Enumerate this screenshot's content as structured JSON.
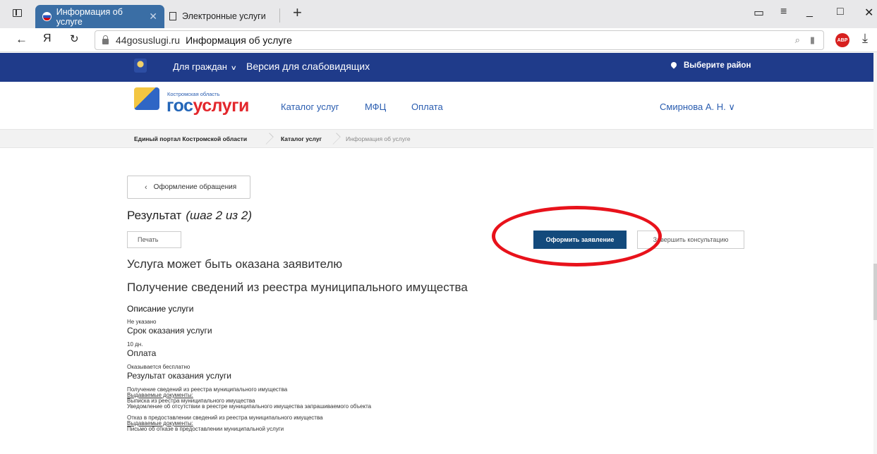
{
  "browser": {
    "active_tab": "Информация об услуге",
    "inactive_tab": "Электронные услуги",
    "yandex_letter": "Я",
    "domain": "44gosuslugi.ru",
    "page_title": "Информация об услуге",
    "abp": "ABP"
  },
  "topbar": {
    "citizens": "Для граждан",
    "vision": "Версия для слабовидящих",
    "district": "Выберите район"
  },
  "header": {
    "logo_region": "Костромская область",
    "logo_gos": "гос",
    "logo_uslugi": "услуги",
    "nav": [
      "Каталог услуг",
      "МФЦ",
      "Оплата"
    ],
    "user": "Смирнова А. Н."
  },
  "breadcrumbs": [
    "Единый портал Костромской области",
    "Каталог услуг",
    "Информация об услуге"
  ],
  "content": {
    "back_label": "Оформление обращения",
    "result_title": "Результат",
    "result_step": "(шаг 2 из 2)",
    "print_label": "Печать",
    "submit_label": "Оформить заявление",
    "finish_label": "Завершить консультацию",
    "served_text": "Услуга может быть оказана заявителю",
    "service_name": "Получение сведений из реестра муниципального имущества",
    "description_heading": "Описание услуги",
    "description_value": "Не указано",
    "term_heading": "Срок оказания услуги",
    "term_value": "10 дн.",
    "payment_heading": "Оплата",
    "payment_value": "Оказывается бесплатно",
    "result_heading": "Результат оказания услуги",
    "result1": {
      "title": "Получение сведений из реестра муниципального имущества",
      "docs_label": "Выдаваемые документы:",
      "docs": [
        "Выписка из реестра муниципального имущества",
        "Уведомление об отсутствии в реестре муниципального имущества запрашиваемого объекта"
      ]
    },
    "result2": {
      "title": "Отказ в предоставлении сведений из реестра муниципального имущества",
      "docs_label": "Выдаваемые документы:",
      "docs": [
        "Письмо об отказе в предоставлении муниципальной услуги"
      ]
    }
  },
  "colors": {
    "topbar": "#1f3b8a",
    "primary_button": "#134a7c",
    "annotation": "#e8121b",
    "link": "#2a5db0"
  }
}
